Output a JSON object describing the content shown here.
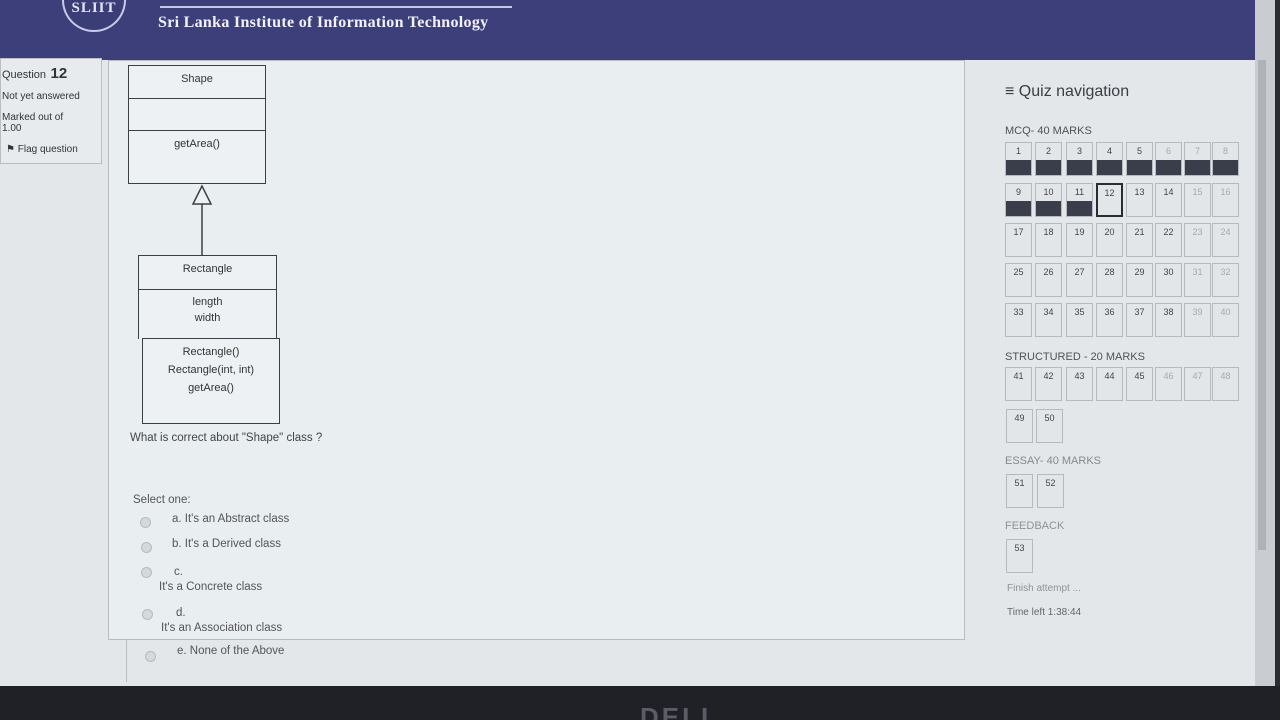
{
  "header": {
    "site_title": "Sri Lanka Institute of Information Technology",
    "logo_text": "SLIIT"
  },
  "question_info": {
    "label": "Question",
    "number": "12",
    "status": "Not yet answered",
    "marked_out_of": "Marked out of",
    "marks": "1.00",
    "flag_label": "Flag question"
  },
  "diagram": {
    "shape": {
      "name": "Shape",
      "methods": [
        "getArea()"
      ]
    },
    "rectangle": {
      "name": "Rectangle",
      "attributes": [
        "length",
        "width"
      ],
      "methods": [
        "Rectangle()",
        "Rectangle(int, int)",
        "getArea()"
      ]
    }
  },
  "question": {
    "text": "What is correct about \"Shape\" class ?",
    "select_one": "Select one:",
    "options": [
      {
        "letter": "a.",
        "text": "It's an Abstract class"
      },
      {
        "letter": "b.",
        "text": "It's a Derived class"
      },
      {
        "letter": "c.",
        "text": "It's a Concrete class"
      },
      {
        "letter": "d.",
        "text": "It's an Association class"
      },
      {
        "letter": "e.",
        "text": "None of the Above"
      }
    ]
  },
  "quiz_nav": {
    "title": "Quiz navigation",
    "sections": [
      {
        "label": "MCQ- 40 MARKS"
      },
      {
        "label": "STRUCTURED - 20 MARKS"
      },
      {
        "label": "ESSAY- 40 MARKS"
      },
      {
        "label": "FEEDBACK"
      }
    ],
    "finish_attempt": "Finish attempt ...",
    "time_left": "Time left 1:38:44"
  },
  "colors": {
    "header_bg": "#3d3f7a",
    "answered": "#3a3d4a"
  }
}
